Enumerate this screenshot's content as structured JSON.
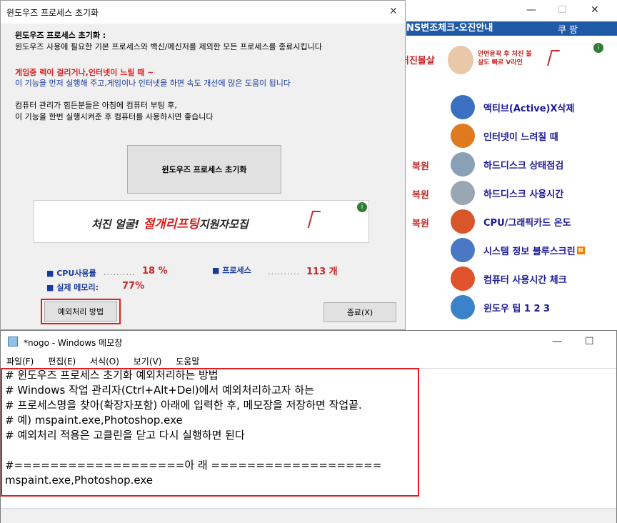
{
  "bg_window": {
    "top_title": "NS변조체크-오진안내",
    "coupon": "쿠 팡",
    "ad_left_text": "처진볼살",
    "ad_right_text": "안면윤곽 후 처진 볼살도 빠르 V라인",
    "menu": [
      {
        "label": "액티브(Active)X삭제",
        "icon": "activex-icon",
        "color": "#3b6fc2",
        "restore": ""
      },
      {
        "label": "인터넷이 느려질 때",
        "icon": "ie-arrow-icon",
        "color": "#e07a1f",
        "restore": ""
      },
      {
        "label": "하드디스크 상태점검",
        "icon": "magnifier-icon",
        "color": "#8aa0b6",
        "restore": "복원"
      },
      {
        "label": "하드디스크 사용시간",
        "icon": "clock-icon",
        "color": "#9aa6b2",
        "restore": "복원"
      },
      {
        "label": "CPU/그래픽카드 온도",
        "icon": "thermometer-icon",
        "color": "#d9562b",
        "restore": "복원"
      },
      {
        "label": "시스템 정보 블루스크린",
        "icon": "computer-icon",
        "color": "#4a78c4",
        "restore": ""
      },
      {
        "label": "컴퓨터 사용시간 체크",
        "icon": "alarm-clock-icon",
        "color": "#e0522b",
        "restore": ""
      },
      {
        "label": "윈도우 팁 1   2   3",
        "icon": "tip-icon",
        "color": "#3a82c9",
        "restore": ""
      }
    ],
    "new_badge": "N"
  },
  "dialog": {
    "title": "윈도우즈 프로세스 초기화",
    "heading": "윈도우즈 프로세스 초기화 :",
    "line1": "윈도우즈 사용에 필요한 기본 프로세스와 백신/메신저를 제외한 모든 프로세스를 종료시킵니다",
    "warn": "게임중 렉이 걸리거나,인터넷이 느릴 때 ~",
    "line2": "이 기능을 먼저 실행해 주고,게임이나 인터넷을 하면 속도 개선에 많은 도움이 됩니다",
    "line3": "컴퓨터 관리가 힘든분들은 아침에 컴퓨터 부팅 후,",
    "line4": "이 기능을 한번 실행시켜준 후 컴퓨터를 사용하시면 좋습니다",
    "main_button": "윈도우즈 프로세스 초기화",
    "banner_text_a": "처진 얼굴! ",
    "banner_text_b": "절개리프팅",
    "banner_text_c": "지원자모집",
    "cpu_label": "■ CPU사용률",
    "cpu_value": "18 %",
    "proc_label": "■ 프로세스",
    "proc_value": "113 개",
    "mem_label": "■ 실제 메모리:",
    "mem_value": "77%",
    "dots": "..........",
    "exception_button": "예외처리 방법",
    "close_button": "종료(X)"
  },
  "notepad": {
    "title": "*nogo - Windows 메모장",
    "menu": [
      "파일(F)",
      "편집(E)",
      "서식(O)",
      "보기(V)",
      "도움말"
    ],
    "lines": [
      "# 윈도우즈 프로세스 초기화 예외처리하는 방법",
      "# Windows 작업 관리자(Ctrl+Alt+Del)에서 예외처리하고자 하는",
      "# 프로세스명을 찾아(확장자포함) 아래에 입력한 후, 메모장을 저장하면 작업끝.",
      "# 예) mspaint.exe,Photoshop.exe",
      "# 예외처리 적용은 고클린을 닫고 다시 실행하면 된다",
      "",
      "#===================아 래 ===================",
      "mspaint.exe,Photoshop.exe"
    ]
  },
  "colors": {
    "highlight_red": "#e02020",
    "accent_blue": "#1f5aa6"
  }
}
